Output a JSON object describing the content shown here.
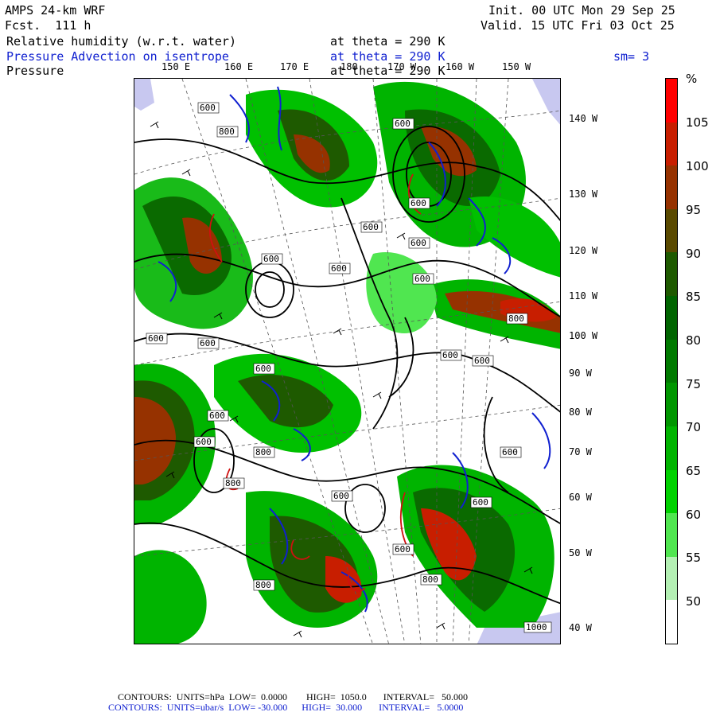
{
  "header": {
    "model": "AMPS 24-km WRF",
    "init": "Init. 00 UTC Mon 29 Sep 25",
    "forecast": "Fcst.  111 h",
    "valid": "Valid. 15 UTC Fri 03 Oct 25",
    "field1_name": "Relative humidity (w.r.t. water)",
    "field1_level": "at theta = 290 K",
    "field2_name": "Pressure Advection on isentrope",
    "field2_level": "at theta = 290 K",
    "field2_smooth": "sm= 3",
    "field3_name": "Pressure",
    "field3_level": "at theta = 290 K"
  },
  "map": {
    "lon_labels": [
      "150 E",
      "160 E",
      "170 E",
      "180",
      "170 W",
      "160 W",
      "150 W"
    ],
    "lat_labels": [
      "140 W",
      "130 W",
      "120 W",
      "110 W",
      "100 W",
      "90 W",
      "80 W",
      "70 W",
      "60 W",
      "50 W",
      "40 W"
    ],
    "contour_labels": [
      "600",
      "800",
      "600",
      "600",
      "600",
      "600",
      "600",
      "600",
      "600",
      "600",
      "600",
      "800",
      "600",
      "600",
      "600",
      "600",
      "800",
      "600",
      "600",
      "600",
      "600",
      "800",
      "800",
      "1000",
      "800",
      "600"
    ]
  },
  "colorbar": {
    "unit": "%",
    "labels": [
      "105",
      "100",
      "95",
      "90",
      "85",
      "80",
      "75",
      "70",
      "65",
      "60",
      "55",
      "50"
    ],
    "colors": [
      "#ff0000",
      "#c81e00",
      "#963200",
      "#5a4a00",
      "#1e5a00",
      "#006400",
      "#007a00",
      "#009600",
      "#00b400",
      "#00d200",
      "#50e650",
      "#b4f0b4",
      "#ffffff"
    ]
  },
  "footer": {
    "line1": "CONTOURS:  UNITS=hPa  LOW=  0.0000        HIGH=  1050.0       INTERVAL=   50.000",
    "line2": "CONTOURS:  UNITS=ubar/s  LOW= -30.000      HIGH=  30.000       INTERVAL=   5.0000"
  }
}
